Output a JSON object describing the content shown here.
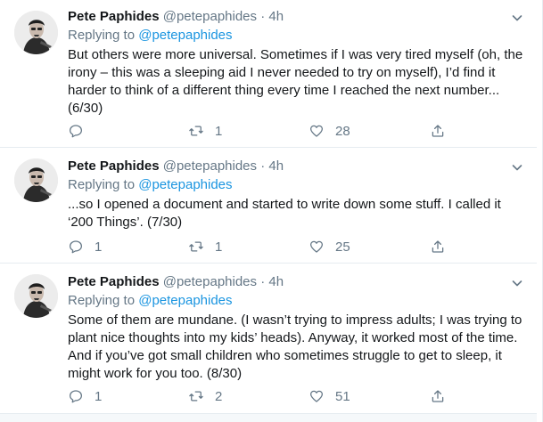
{
  "tweets": [
    {
      "name": "Pete Paphides",
      "handle": "@petepaphides",
      "separator": "·",
      "time": "4h",
      "replying_prefix": "Replying to",
      "replying_handle": "@petepaphides",
      "text": "But others were more universal. Sometimes if I was very tired myself (oh, the irony – this was a sleeping aid I never needed to try on myself), I’d find it harder to think of a different thing every time I reached the next number... (6/30)",
      "replies": "",
      "retweets": "1",
      "likes": "28"
    },
    {
      "name": "Pete Paphides",
      "handle": "@petepaphides",
      "separator": "·",
      "time": "4h",
      "replying_prefix": "Replying to",
      "replying_handle": "@petepaphides",
      "text": "...so I opened a document and started to write down some stuff. I called it ‘200 Things’. (7/30)",
      "replies": "1",
      "retweets": "1",
      "likes": "25"
    },
    {
      "name": "Pete Paphides",
      "handle": "@petepaphides",
      "separator": "·",
      "time": "4h",
      "replying_prefix": "Replying to",
      "replying_handle": "@petepaphides",
      "text": "Some of them are mundane. (I wasn’t trying to impress adults; I was trying to plant nice thoughts into my kids’ heads). Anyway, it worked most of the time. And if you’ve got small children who sometimes struggle to get to sleep, it might work for you too. (8/30)",
      "replies": "1",
      "retweets": "2",
      "likes": "51"
    }
  ],
  "icons": {
    "reply": "reply-icon",
    "retweet": "retweet-icon",
    "like": "heart-icon",
    "share": "share-icon",
    "caret": "chevron-down-icon"
  },
  "colors": {
    "link": "#1b95e0",
    "muted": "#657786",
    "text": "#14171a",
    "border": "#e6ecf0"
  }
}
